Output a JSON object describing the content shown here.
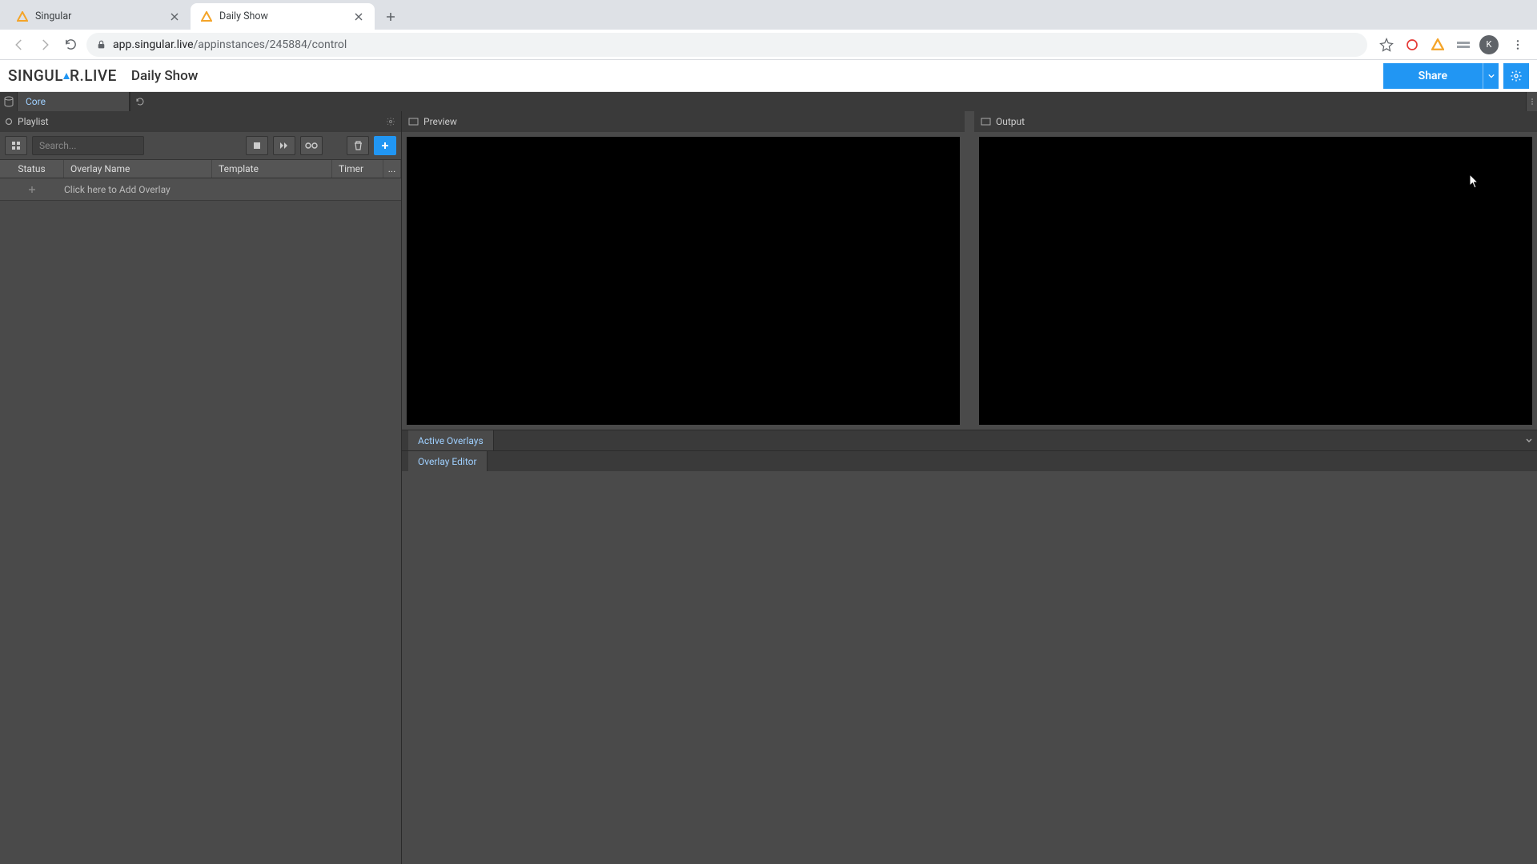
{
  "browser": {
    "tabs": [
      {
        "title": "Singular",
        "active": false
      },
      {
        "title": "Daily Show",
        "active": true
      }
    ],
    "url_domain": "app.singular.live",
    "url_path": "/appinstances/245884/control",
    "avatar_letter": "K"
  },
  "app": {
    "brand_pre": "SINGUL",
    "brand_post": "R.LIVE",
    "show_name": "Daily Show",
    "share_label": "Share"
  },
  "layers": {
    "tab_label": "Core"
  },
  "playlist": {
    "header_label": "Playlist",
    "search_placeholder": "Search...",
    "columns": {
      "status": "Status",
      "name": "Overlay Name",
      "template": "Template",
      "timer": "Timer",
      "more": "..."
    },
    "add_row_label": "Click here to Add Overlay"
  },
  "preview": {
    "label": "Preview"
  },
  "output": {
    "label": "Output"
  },
  "sections": {
    "active_overlays": "Active Overlays",
    "overlay_editor": "Overlay Editor"
  }
}
